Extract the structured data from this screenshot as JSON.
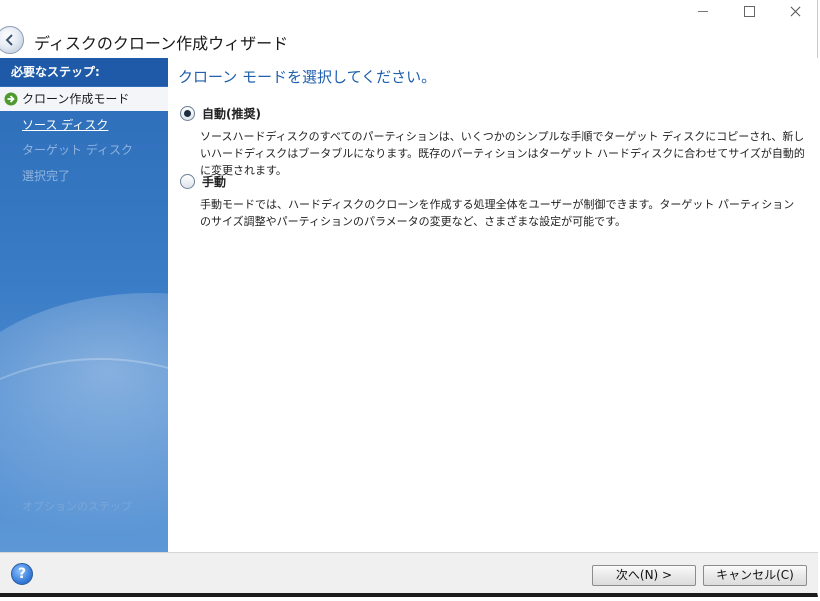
{
  "window": {
    "title": "ディスクのクローン作成ウィザード"
  },
  "sidebar": {
    "header": "必要なステップ:",
    "steps": [
      {
        "label": "クローン作成モード",
        "state": "active"
      },
      {
        "label": "ソース ディスク",
        "state": "link"
      },
      {
        "label": "ターゲット ディスク",
        "state": "disabled"
      },
      {
        "label": "選択完了",
        "state": "disabled"
      }
    ],
    "optional_label": "オプションのステップ"
  },
  "content": {
    "title": "クローン モードを選択してください。",
    "options": [
      {
        "label": "自動(推奨)",
        "checked": true,
        "description": "ソースハードディスクのすべてのパーティションは、いくつかのシンプルな手順でターゲット ディスクにコピーされ、新しいハードディスクはブータブルになります。既存のパーティションはターゲット ハードディスクに合わせてサイズが自動的に変更されます。"
      },
      {
        "label": "手動",
        "checked": false,
        "description": "手動モードでは、ハードディスクのクローンを作成する処理全体をユーザーが制御できます。ターゲット パーティションのサイズ調整やパーティションのパラメータの変更など、さまざまな設定が可能です。"
      }
    ]
  },
  "footer": {
    "help_icon": "?",
    "next_label": "次へ(N) >",
    "cancel_label": "キャンセル(C)"
  },
  "colors": {
    "sidebar_header": "#1e5aa8",
    "sidebar": "#3a7cc6",
    "content_title": "#1f5fad"
  }
}
